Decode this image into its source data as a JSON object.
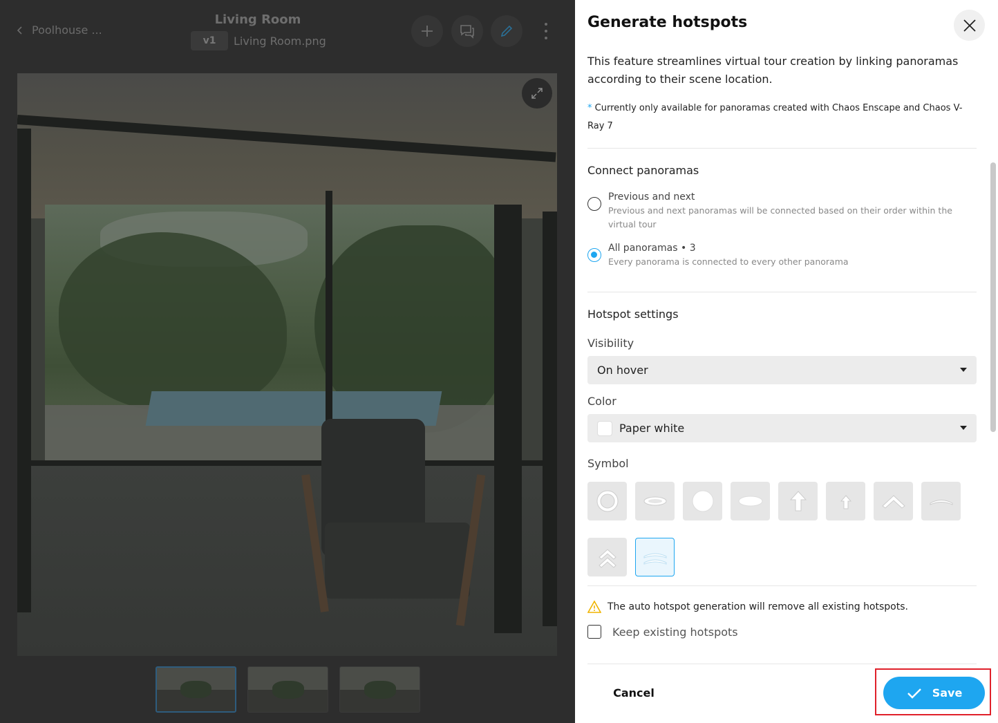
{
  "viewer": {
    "back_label": "Poolhouse ...",
    "room_title": "Living Room",
    "version_badge": "v1",
    "file_name": "Living Room.png",
    "toolbar_icons": [
      "plus-icon",
      "comments-icon",
      "pencil-icon",
      "more-vertical-icon"
    ],
    "thumbnail_count": 3,
    "active_thumbnail_index": 0
  },
  "panel": {
    "title": "Generate hotspots",
    "intro": "This feature streamlines virtual tour creation by linking panoramas according to their scene location.",
    "note_marker": "*",
    "note": "Currently only available for panoramas created with Chaos Enscape and Chaos V-Ray 7",
    "connect": {
      "title": "Connect panoramas",
      "options": [
        {
          "label": "Previous and next",
          "description": "Previous and next panoramas will be connected based on their order within the virtual tour",
          "checked": false
        },
        {
          "label": "All panoramas • 3",
          "description": "Every panorama is connected to every other panorama",
          "checked": true
        }
      ]
    },
    "hotspot": {
      "title": "Hotspot settings",
      "visibility_label": "Visibility",
      "visibility_value": "On hover",
      "color_label": "Color",
      "color_value": "Paper white",
      "color_swatch": "#ffffff",
      "symbol_label": "Symbol",
      "symbols": [
        "ring-symbol",
        "flat-ring-symbol",
        "dot-symbol",
        "flat-dot-symbol",
        "arrow-up-symbol",
        "small-arrow-up-symbol",
        "chevron-up-symbol",
        "flat-chevron-symbol",
        "double-chevron-symbol",
        "double-flat-chevron-symbol"
      ],
      "selected_symbol_index": 9
    },
    "warning": "The auto hotspot generation will remove all existing hotspots.",
    "keep_existing": {
      "label": "Keep existing hotspots",
      "checked": false
    },
    "cancel_label": "Cancel",
    "save_label": "Save",
    "accent_color": "#1ea6f0",
    "highlight_color": "#e0202a"
  }
}
